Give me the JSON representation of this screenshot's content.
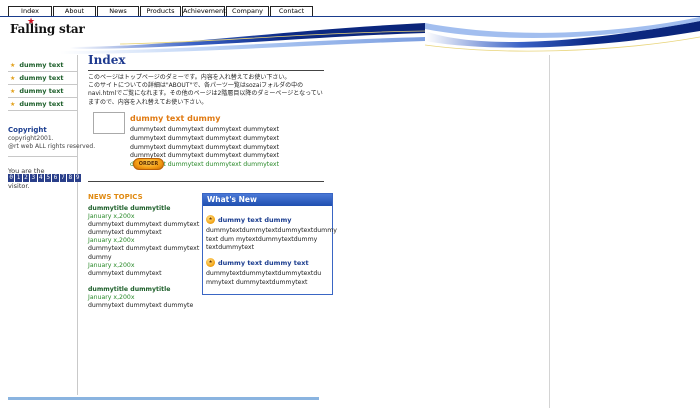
{
  "nav": {
    "tabs": [
      "Index",
      "About",
      "News",
      "Products",
      "Achievement",
      "Company",
      "Contact"
    ]
  },
  "header": {
    "logo": "Falling star",
    "logo_star": "★"
  },
  "sidebar": {
    "items": [
      "dummy text",
      "dummy text",
      "dummy text",
      "dummy text"
    ],
    "bullet": "★",
    "copyright_title": "Copyright",
    "copyright_lines": [
      "copyright2001.",
      "@rt web ALL rights reserved."
    ],
    "counter_label": "You are the",
    "counter_digits": [
      "0",
      "1",
      "2",
      "3",
      "4",
      "5",
      "6",
      "7",
      "8",
      "9"
    ],
    "visitor_label": "visitor."
  },
  "main": {
    "title": "Index",
    "intro": [
      "このページはトップページのダミーです。内容を入れ替えてお使い下さい。",
      "このサイトについての詳細は\"ABOUT\"で、各パーツ一覧はsozaiフォルダの中の",
      "navi.htmlでご覧になれます。その他のページは2階層目以降のダミーページとなってい",
      "ますので、内容を入れ替えてお使い下さい。"
    ],
    "product": {
      "title": "dummy text dummy",
      "lines": [
        "dummytext dummytext dummytext dummytext",
        "dummytext dummytext dummytext dummytext",
        "dummytext dummytext dummytext dummytext",
        "dummytext dummytext dummytext dummytext"
      ],
      "green_line": "dummytext dummytext dummytext dummytext",
      "order_label": "ORDER"
    },
    "news": {
      "header": "NEWS TOPICS",
      "items": [
        {
          "title": "dummytitle dummytitle",
          "date": "January x,200x",
          "text": [
            "dummytext dummytext dummytext",
            "dummytext dummytext"
          ]
        },
        {
          "title": "",
          "date": "January x,200x",
          "text": [
            "dummytext dummytext dummytext",
            "dummy"
          ]
        },
        {
          "title": "",
          "date": "January x,200x",
          "text": [
            "dummytext dummytext"
          ]
        },
        {
          "title": "dummytitle dummytitle",
          "date": "January x,200x",
          "text": [
            "dummytext dummytext dummyte"
          ]
        }
      ]
    },
    "whats_new": {
      "header": "What's New",
      "items": [
        {
          "title": "dummy text dummy",
          "icon": "new-badge-icon",
          "text": [
            "dummytextdummytextdummytextdummy",
            "text dum mytextdummytextdummy",
            "textdummytext"
          ]
        },
        {
          "title": "dummy text dummy text",
          "icon": "new-badge-icon",
          "text": [
            "dummytextdummytextdummytextdu",
            "mmytext dummytextdummytext"
          ]
        }
      ]
    }
  }
}
